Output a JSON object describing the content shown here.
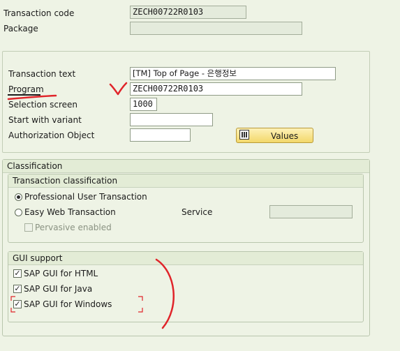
{
  "header": {
    "transaction_code_label": "Transaction code",
    "transaction_code_value": "ZECH00722R0103",
    "package_label": "Package",
    "package_value": ""
  },
  "attributes": {
    "transaction_text_label": "Transaction text",
    "transaction_text_value": "[TM] Top of Page - 은행정보",
    "program_label": "Program",
    "program_value": "ZECH00722R0103",
    "selection_screen_label": "Selection screen",
    "selection_screen_value": "1000",
    "start_with_variant_label": "Start with variant",
    "start_with_variant_value": "",
    "authorization_object_label": "Authorization Object",
    "authorization_object_value": "",
    "values_button_label": "Values"
  },
  "classification": {
    "title": "Classification",
    "transaction_classification": {
      "title": "Transaction classification",
      "professional_label": "Professional User Transaction",
      "professional_selected": true,
      "easy_web_label": "Easy Web Transaction",
      "easy_web_selected": false,
      "service_label": "Service",
      "service_value": "",
      "pervasive_label": "Pervasive enabled",
      "pervasive_checked": false
    },
    "gui_support": {
      "title": "GUI support",
      "html_label": "SAP GUI for HTML",
      "html_checked": true,
      "java_label": "SAP GUI for Java",
      "java_checked": true,
      "windows_label": "SAP GUI for Windows",
      "windows_checked": true
    }
  },
  "colors": {
    "background": "#eef3e5",
    "annotation": "#e0242a",
    "button_fill": "#f3d86a"
  }
}
